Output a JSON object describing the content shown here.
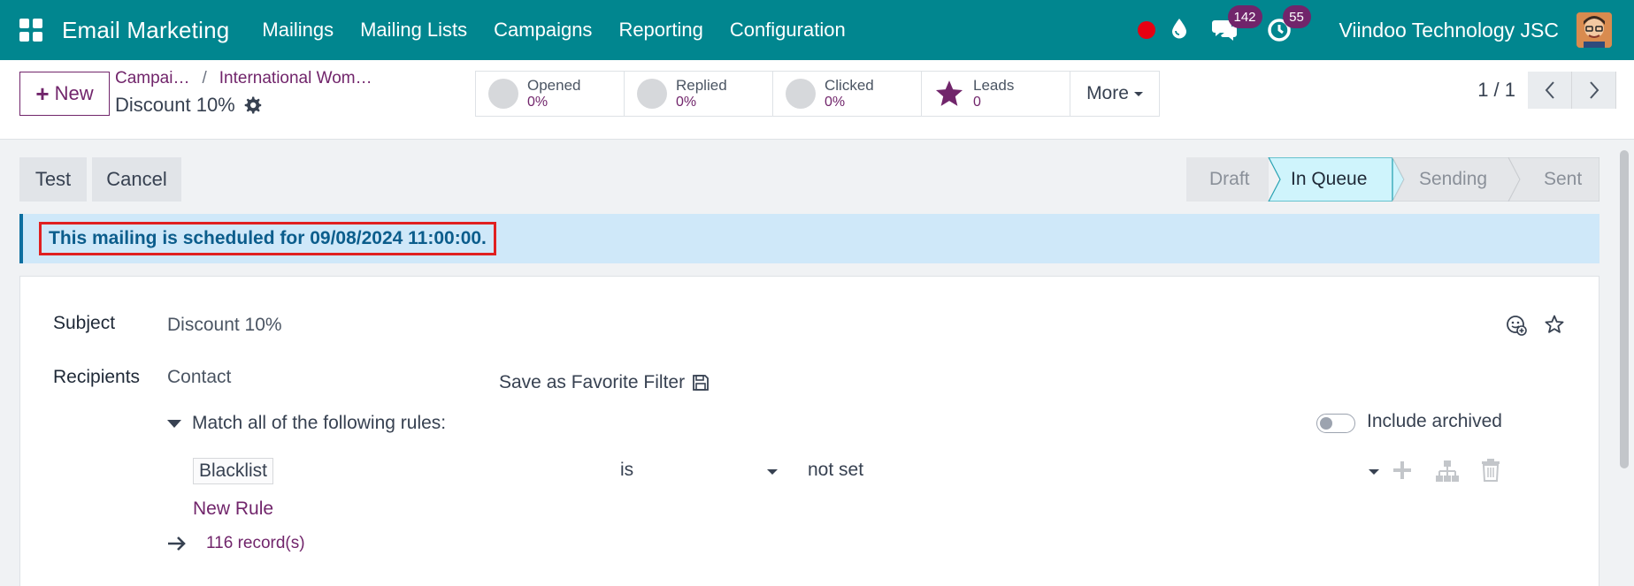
{
  "navbar": {
    "app_name": "Email Marketing",
    "menu": [
      "Mailings",
      "Mailing Lists",
      "Campaigns",
      "Reporting",
      "Configuration"
    ],
    "messages_count": "142",
    "activities_count": "55",
    "company": "Viindoo Technology JSC"
  },
  "control": {
    "new_label": "New",
    "breadcrumb": [
      "Campai…",
      "International Wom…"
    ],
    "record_title": "Discount 10%",
    "stats": [
      {
        "label": "Opened",
        "value": "0%"
      },
      {
        "label": "Replied",
        "value": "0%"
      },
      {
        "label": "Clicked",
        "value": "0%"
      },
      {
        "label": "Leads",
        "value": "0"
      }
    ],
    "more_label": "More",
    "pager": "1 / 1"
  },
  "actions": {
    "test_label": "Test",
    "cancel_label": "Cancel"
  },
  "statusbar": [
    "Draft",
    "In Queue",
    "Sending",
    "Sent"
  ],
  "alert": {
    "text": "This mailing is scheduled for 09/08/2024 11:00:00."
  },
  "form": {
    "subject_label": "Subject",
    "subject_value": "Discount 10%",
    "recipients_label": "Recipients",
    "recipients_value": "Contact",
    "save_filter": "Save as Favorite Filter",
    "match_rules": "Match all of the following rules:",
    "include_archived": "Include archived",
    "rule": {
      "field": "Blacklist",
      "operator": "is",
      "value": "not set"
    },
    "new_rule": "New Rule",
    "records": "116 record(s)"
  }
}
